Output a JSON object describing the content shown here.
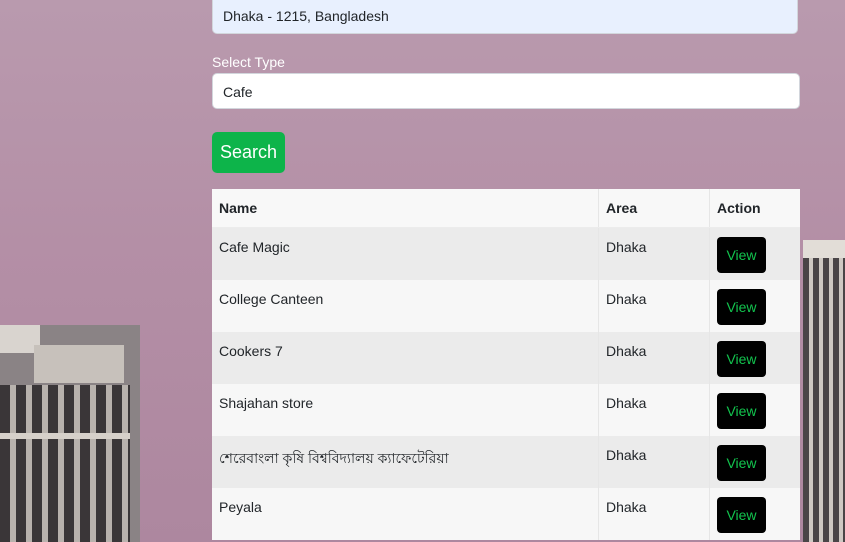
{
  "search": {
    "location_value": "Dhaka - 1215, Bangladesh",
    "type_label": "Select Type",
    "type_value": "Cafe",
    "button_label": "Search"
  },
  "table": {
    "headers": [
      "Name",
      "Area",
      "Action"
    ],
    "rows": [
      {
        "name": "Cafe Magic",
        "area": "Dhaka",
        "action": "View"
      },
      {
        "name": "College Canteen",
        "area": "Dhaka",
        "action": "View"
      },
      {
        "name": "Cookers 7",
        "area": "Dhaka",
        "action": "View"
      },
      {
        "name": "Shajahan store",
        "area": "Dhaka",
        "action": "View"
      },
      {
        "name": "শেরেবাংলা কৃষি বিশ্ববিদ্যালয় ক্যাফেটেরিয়া",
        "area": "Dhaka",
        "action": "View"
      },
      {
        "name": "Peyala",
        "area": "Dhaka",
        "action": "View"
      }
    ]
  },
  "colors": {
    "search_button": "#0db44a",
    "view_button_bg": "#000000",
    "view_button_text": "#12c44e",
    "background": "#b48fa6"
  }
}
